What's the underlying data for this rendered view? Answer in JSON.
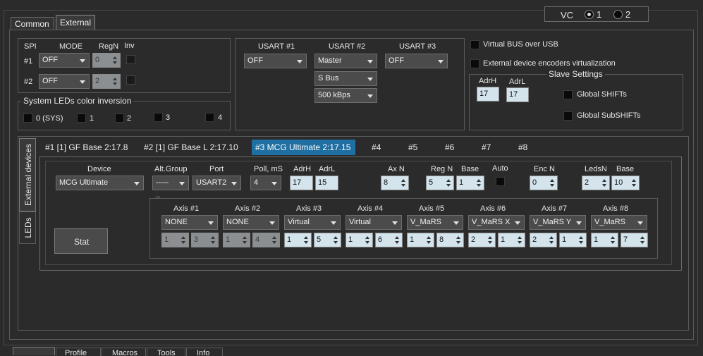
{
  "top_tabs": [
    "Common",
    "External"
  ],
  "vc": {
    "label": "VC",
    "opt1": "1",
    "opt2": "2"
  },
  "spi": {
    "col_spi": "SPI",
    "col_mode": "MODE",
    "col_regn": "RegN",
    "col_inv": "Inv",
    "rows": [
      {
        "label": "#1",
        "mode": "OFF",
        "regn": "0"
      },
      {
        "label": "#2",
        "mode": "OFF",
        "regn": "2"
      }
    ]
  },
  "leds_inv": {
    "title": "System LEDs color inversion",
    "items": [
      "0 (SYS)",
      "1",
      "2",
      "3",
      "4"
    ]
  },
  "usart": {
    "u1": {
      "label": "USART #1",
      "value": "OFF"
    },
    "u2": {
      "label": "USART #2",
      "value": "Master",
      "protocol": "S Bus",
      "speed": "500 kBps"
    },
    "u3": {
      "label": "USART #3",
      "value": "OFF"
    }
  },
  "virtual_bus": "Virtual BUS over USB",
  "enc_virt": "External device encoders virtualization",
  "slave": {
    "title": "Slave Settings",
    "adrh_label": "AdrH",
    "adrh": "17",
    "adrl_label": "AdrL",
    "adrl": "17",
    "global_shifts": "Global SHIFTs",
    "global_subshifts": "Global SubSHIFTs"
  },
  "side_tabs": [
    "External devices",
    "LEDs"
  ],
  "device_tabs": [
    "#1 [1] GF Base 2:17.8",
    "#2 [1] GF Base L 2:17.10",
    "#3 MCG Ultimate 2:17.15",
    "#4",
    "#5",
    "#6",
    "#7",
    "#8"
  ],
  "device": {
    "device_label": "Device",
    "device": "MCG Ultimate",
    "altgroup_label": "Alt.Group",
    "altgroup": "-----",
    "port_label": "Port",
    "port": "USART2",
    "poll_label": "Poll, mS",
    "poll": "4",
    "adrh_label": "AdrH",
    "adrh": "17",
    "adrl_label": "AdrL",
    "adrl": "15",
    "axn_label": "Ax N",
    "axn": "8",
    "regn_label": "Reg N",
    "regn": "5",
    "base_label": "Base",
    "base": "1",
    "auto_label": "Auto",
    "encn_label": "Enc N",
    "encn": "0",
    "ledsn_label": "LedsN",
    "ledsn": "2",
    "base2_label": "Base",
    "base2": "10",
    "dots": "...",
    "stat_button": "Stat"
  },
  "axes": [
    {
      "label": "Axis #1",
      "value": "NONE",
      "a": "1",
      "b": "3",
      "disabled": true
    },
    {
      "label": "Axis #2",
      "value": "NONE",
      "a": "1",
      "b": "4",
      "disabled": true
    },
    {
      "label": "Axis #3",
      "value": "Virtual",
      "a": "1",
      "b": "5",
      "disabled": false
    },
    {
      "label": "Axis #4",
      "value": "Virtual",
      "a": "1",
      "b": "6",
      "disabled": false
    },
    {
      "label": "Axis #5",
      "value": "V_MaRS",
      "a": "1",
      "b": "8",
      "disabled": false
    },
    {
      "label": "Axis #6",
      "value": "V_MaRS X",
      "a": "2",
      "b": "1",
      "disabled": false
    },
    {
      "label": "Axis #7",
      "value": "V_MaRS Y",
      "a": "2",
      "b": "1",
      "disabled": false
    },
    {
      "label": "Axis #8",
      "value": "V_MaRS",
      "a": "1",
      "b": "7",
      "disabled": false
    }
  ],
  "bottom_tabs": [
    "Profile",
    "Macros",
    "Tools",
    "Info"
  ],
  "colors": {
    "accent_tab": "#1f6fa3",
    "background": "#2b2b2b",
    "field": "#d4e4ec"
  }
}
